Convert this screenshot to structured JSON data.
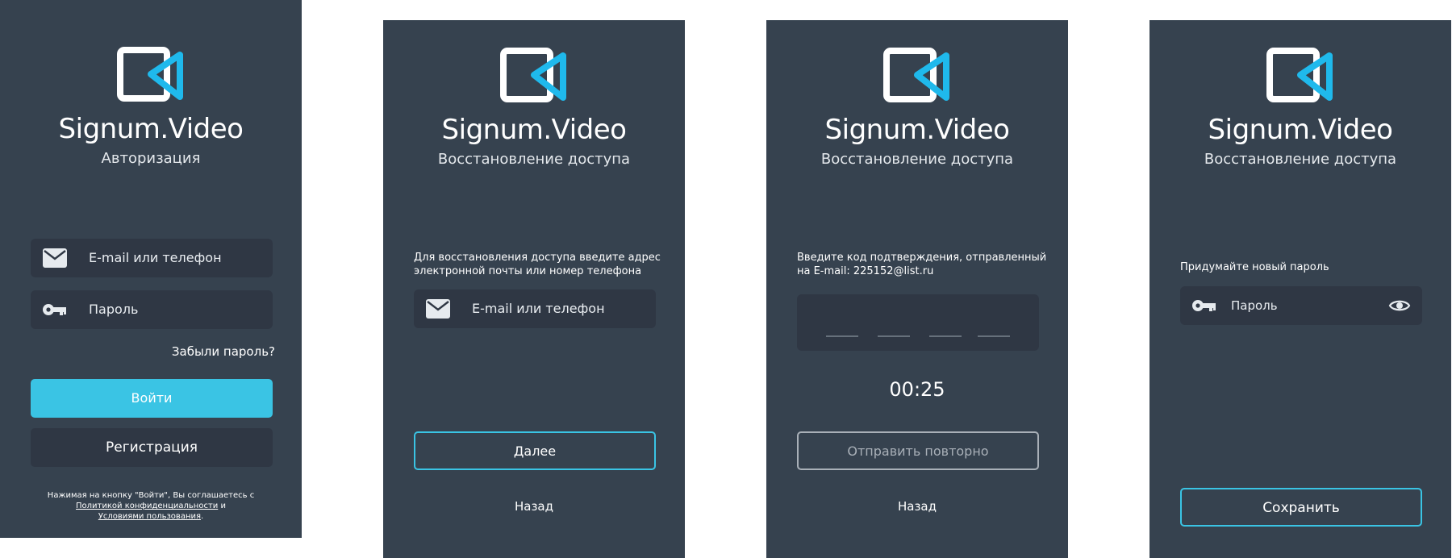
{
  "brand_name": "Signum.Video",
  "colors": {
    "panel": "#36424f",
    "field": "#2f3744",
    "accent": "#3ac4e4",
    "white": "#ffffff"
  },
  "login": {
    "subtitle": "Авторизация",
    "login_placeholder": "E-mail или телефон",
    "password_placeholder": "Пароль",
    "forgot": "Забыли пароль?",
    "login_button": "Войти",
    "register_button": "Регистрация",
    "legal_line1": "Нажимая на кнопку \"Войти\", Вы соглашаетесь с",
    "privacy_link": "Политикой конфиденциальности",
    "and": "и",
    "terms_link": "Условиями пользования",
    "period": "."
  },
  "recover": {
    "subtitle": "Восстановление доступа",
    "instruction": "Для восстановления доступа введите адрес электронной почты или номер телефона",
    "login_placeholder": "E-mail или телефон",
    "next_button": "Далее",
    "back": "Назад"
  },
  "verify": {
    "subtitle": "Восстановление доступа",
    "instruction": "Введите код подтверждения, отправленный на E-mail: 225152@list.ru",
    "timer": "00:25",
    "resend_button": "Отправить повторно",
    "back": "Назад"
  },
  "new_password": {
    "subtitle": "Восстановление доступа",
    "instruction": "Придумайте новый пароль",
    "password_placeholder": "Пароль",
    "save_button": "Сохранить"
  },
  "icons": {
    "logo": "play-frame-logo",
    "email": "envelope-icon",
    "password": "key-icon",
    "show": "eye-icon"
  }
}
